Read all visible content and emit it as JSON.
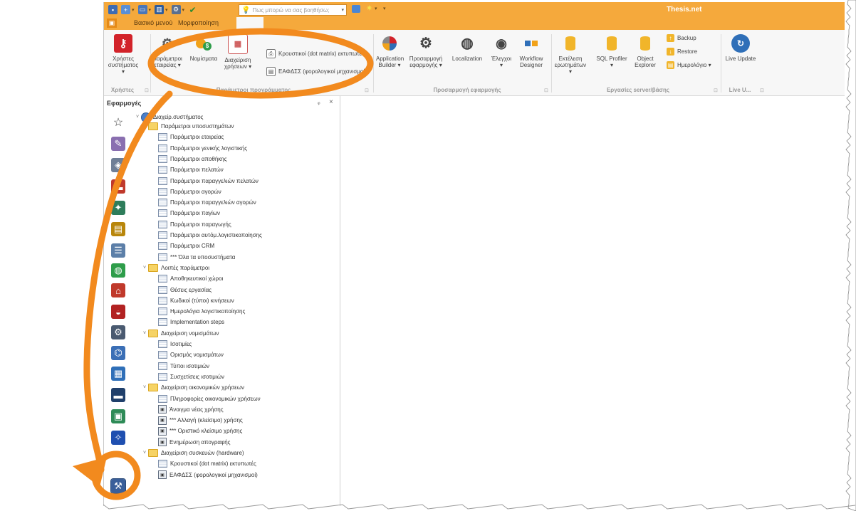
{
  "window": {
    "title": "Thesis.net",
    "help_placeholder": "Πως μπορώ να σας βοηθήσω;"
  },
  "tabs": [
    {
      "label": "Βασικό μενού"
    },
    {
      "label": "Μορφοποίηση"
    }
  ],
  "ribbon": {
    "groups": [
      {
        "label": "Χρήστες"
      },
      {
        "label": "Παράμετροι προγράμματος"
      },
      {
        "label": "Προσαρμογή εφαρμογής"
      },
      {
        "label": "Εργασίες server/βάσης"
      },
      {
        "label": "Live U..."
      }
    ],
    "users": {
      "label": "Χρήστες συστήματος ▾"
    },
    "company_params": {
      "label": "Παράμετροι εταιρείας ▾"
    },
    "currencies": {
      "label": "Νομίσματα"
    },
    "fiscal_years": {
      "label": "Διαχείριση χρήσεων ▾"
    },
    "dot_matrix": {
      "label": "Κρουστικοί (dot matrix) εκτυπωτές"
    },
    "fiscal_devices": {
      "label": "ΕΑΦΔΣΣ (φορολογικοί μηχανισμοί)"
    },
    "app_builder": {
      "label": "Application Builder ▾"
    },
    "customize_app": {
      "label": "Προσαρμογή εφαρμογής ▾"
    },
    "localization": {
      "label": "Localization"
    },
    "checks": {
      "label": "Έλεγχοι ▾"
    },
    "workflow": {
      "label": "Workflow Designer"
    },
    "run_queries": {
      "label": "Εκτέλεση ερωτημάτων ▾"
    },
    "sql_profiler": {
      "label": "SQL Profiler ▾"
    },
    "object_explorer": {
      "label": "Object Explorer"
    },
    "backup": {
      "label": "Backup"
    },
    "restore": {
      "label": "Restore"
    },
    "calendar": {
      "label": "Ημερολόγιο ▾"
    },
    "live_update": {
      "label": "Live Update"
    }
  },
  "panel": {
    "title": "Εφαρμογές",
    "pin": "ᵩ",
    "close": "×"
  },
  "tree": {
    "root": "Διαχείρ.συστήματος",
    "nodes": [
      {
        "label": "Παράμετροι υποσυστημάτων",
        "type": "folder"
      },
      {
        "label": "Παράμετροι εταιρείας",
        "type": "grid"
      },
      {
        "label": "Παράμετροι γενικής λογιστικής",
        "type": "grid"
      },
      {
        "label": "Παράμετροι αποθήκης",
        "type": "grid"
      },
      {
        "label": "Παράμετροι πελατών",
        "type": "grid"
      },
      {
        "label": "Παράμετροι παραγγελιών πελατών",
        "type": "grid"
      },
      {
        "label": "Παράμετροι αγορών",
        "type": "grid"
      },
      {
        "label": "Παράμετροι παραγγελιών αγορών",
        "type": "grid"
      },
      {
        "label": "Παράμετροι παγίων",
        "type": "grid"
      },
      {
        "label": "Παράμετροι παραγωγής",
        "type": "grid"
      },
      {
        "label": "Παράμετροι αυτόμ.λογιστικοποίησης",
        "type": "grid"
      },
      {
        "label": "Παράμετροι CRM",
        "type": "grid"
      },
      {
        "label": "*** Όλα τα υποσυστήματα",
        "type": "grid"
      },
      {
        "label": "Λοιπές παράμετροι",
        "type": "folder"
      },
      {
        "label": "Αποθηκευτικοί χώροι",
        "type": "grid"
      },
      {
        "label": "Θέσεις εργασίας",
        "type": "grid"
      },
      {
        "label": "Κωδικοί (τύποι) κινήσεων",
        "type": "grid"
      },
      {
        "label": "Ημερολόγια λογιστικοποίησης",
        "type": "grid"
      },
      {
        "label": "Implementation steps",
        "type": "grid"
      },
      {
        "label": "Διαχείριση νομισμάτων",
        "type": "folder"
      },
      {
        "label": "Ισοτιμίες",
        "type": "grid"
      },
      {
        "label": "Ορισμός νομισμάτων",
        "type": "grid"
      },
      {
        "label": "Τύποι ισοτιμιών",
        "type": "grid"
      },
      {
        "label": "Συσχετίσεις ισοτιμιών",
        "type": "grid"
      },
      {
        "label": "Διαχείριση οικονομικών χρήσεων",
        "type": "folder"
      },
      {
        "label": "Πληροφορίες οικονομικών χρήσεων",
        "type": "grid"
      },
      {
        "label": "Άνοιγμα νέας χρήσης",
        "type": "wizard"
      },
      {
        "label": "*** Αλλαγή (κλείσιμο) χρήσης",
        "type": "wizard"
      },
      {
        "label": "*** Οριστικό κλείσιμο χρήσης",
        "type": "wizard"
      },
      {
        "label": "Ενημέρωση απογραφής",
        "type": "wizard"
      },
      {
        "label": "Διαχείριση συσκευών (hardware)",
        "type": "folder"
      },
      {
        "label": "Κρουστικοί (dot matrix) εκτυπωτές",
        "type": "grid"
      },
      {
        "label": "ΕΑΦΔΣΣ (φορολογικοί μηχανισμοί)",
        "type": "wizard"
      }
    ]
  },
  "sidebar_icons": [
    "star-icon",
    "brush-icon",
    "tag-icon",
    "cash-register-icon",
    "people-icon",
    "truck-icon",
    "list-icon",
    "globe-icon",
    "house-icon",
    "basket-icon",
    "gears-icon",
    "network-icon",
    "calendar-icon",
    "screen-icon",
    "excel-icon",
    "eu-flag-icon",
    "admin-tools-icon"
  ],
  "colors": {
    "accent": "#f5a93c",
    "annotation": "#f28a1e",
    "ribbon_bg": "#f7f7f7"
  }
}
